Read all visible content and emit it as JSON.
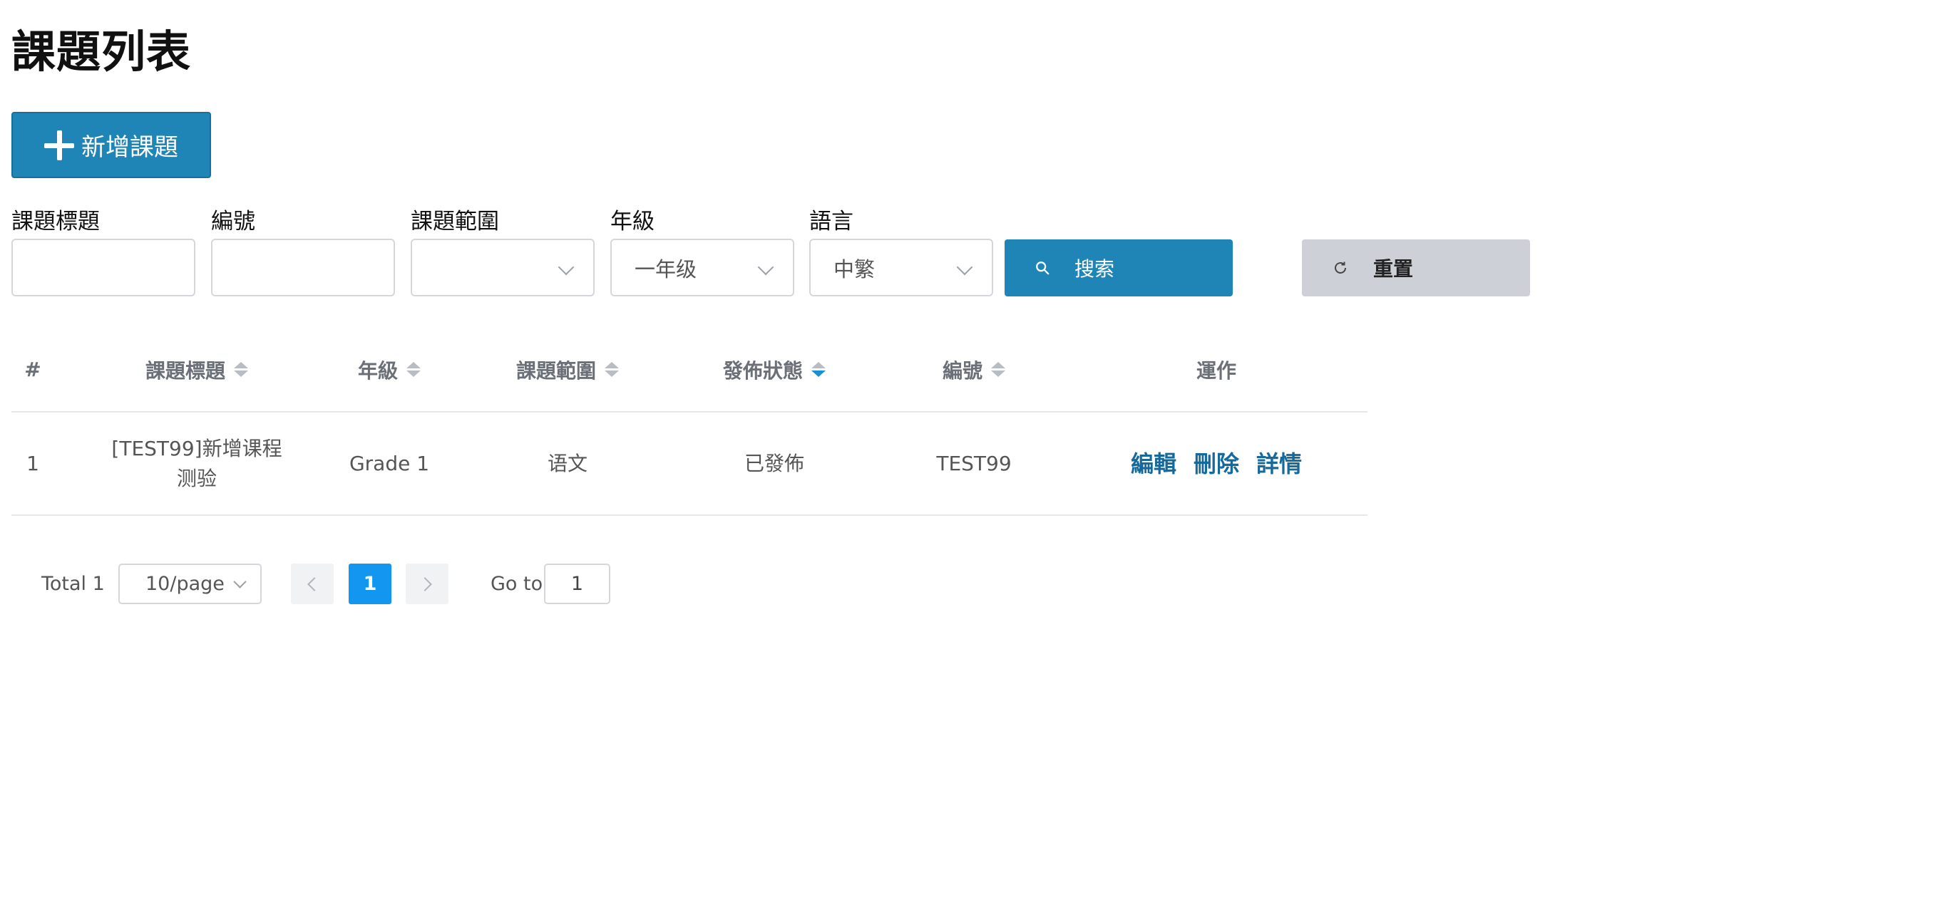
{
  "page": {
    "title": "課題列表"
  },
  "toolbar": {
    "add_label": "新增課題"
  },
  "filters": {
    "title_label": "課題標題",
    "title_value": "",
    "code_label": "編號",
    "code_value": "",
    "scope_label": "課題範圍",
    "scope_value": "",
    "grade_label": "年級",
    "grade_value": "一年级",
    "language_label": "語言",
    "language_value": "中繁",
    "search_label": "搜索",
    "reset_label": "重置"
  },
  "table": {
    "columns": [
      "#",
      "課題標題",
      "年級",
      "課題範圍",
      "發佈狀態",
      "編號",
      "運作"
    ],
    "rows": [
      {
        "index": "1",
        "title": "[TEST99]新增课程测验",
        "grade": "Grade 1",
        "scope": "语文",
        "status": "已發佈",
        "code": "TEST99",
        "actions": {
          "edit": "編輯",
          "delete": "刪除",
          "details": "詳情"
        }
      }
    ]
  },
  "pagination": {
    "total": "Total 1",
    "page_size": "10/page",
    "current_page": "1",
    "goto_label": "Go to",
    "goto_value": "1"
  },
  "colors": {
    "primary": "#1f84b6",
    "active_page": "#1296f0",
    "reset_bg": "#cdd0d7",
    "link": "#16699b"
  }
}
